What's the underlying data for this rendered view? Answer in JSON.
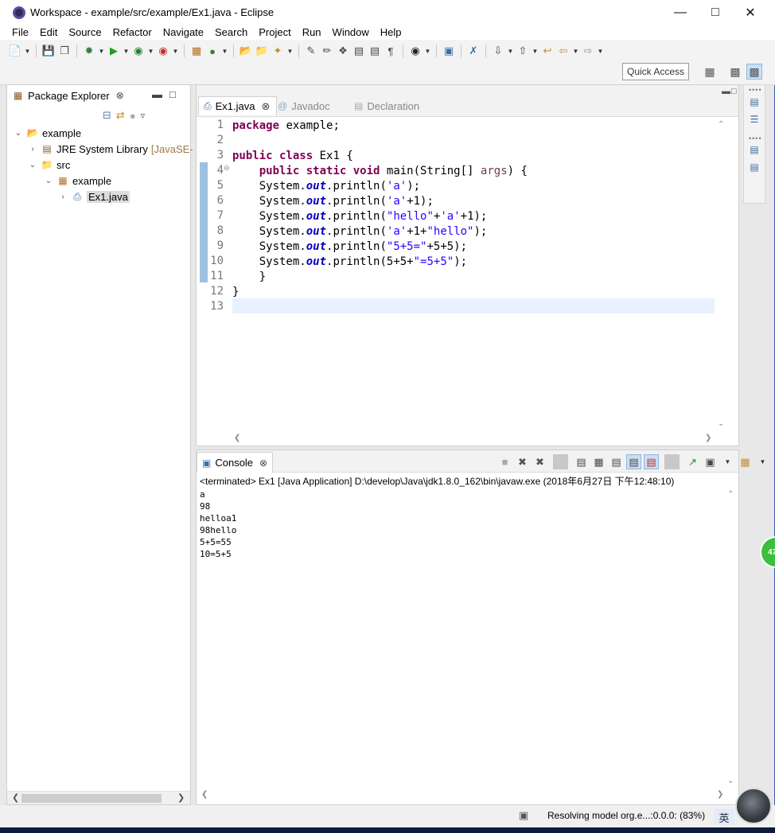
{
  "window": {
    "title": "Workspace - example/src/example/Ex1.java - Eclipse"
  },
  "menu": [
    "File",
    "Edit",
    "Source",
    "Refactor",
    "Navigate",
    "Search",
    "Project",
    "Run",
    "Window",
    "Help"
  ],
  "toolbar": {
    "quick_access": "Quick Access"
  },
  "package_explorer": {
    "title": "Package Explorer",
    "tree": [
      {
        "label": "example",
        "arrow": "⌄",
        "icon": "project-icon"
      },
      {
        "label": "JRE System Library",
        "suffix": "[JavaSE-",
        "arrow": "›",
        "icon": "library-icon"
      },
      {
        "label": "src",
        "arrow": "⌄",
        "icon": "source-folder-icon"
      },
      {
        "label": "example",
        "arrow": "⌄",
        "icon": "package-icon"
      },
      {
        "label": "Ex1.java",
        "arrow": "›",
        "icon": "java-file-icon"
      }
    ]
  },
  "editor": {
    "tabs": [
      {
        "label": "Ex1.java",
        "active": true
      },
      {
        "label": "Javadoc",
        "active": false
      },
      {
        "label": "Declaration",
        "active": false
      }
    ],
    "line_numbers": [
      "1",
      "2",
      "3",
      "4",
      "5",
      "6",
      "7",
      "8",
      "9",
      "10",
      "11",
      "12",
      "13"
    ],
    "code": {
      "l1_kw": "package",
      "l1_rest": " example;",
      "l3_kw1": "public",
      "l3_kw2": "class",
      "l3_rest": " Ex1 {",
      "l4_kw1": "public",
      "l4_kw2": "static",
      "l4_kw3": "void",
      "l4_mid": " main(String[] ",
      "l4_par": "args",
      "l4_end": ") {",
      "sys": "System.",
      "out": "out",
      "println": ".println(",
      "l5_str": "'a'",
      "l5_end": ");",
      "l6_str": "'a'",
      "l6_end": "+1);",
      "l7_str1": "\"hello\"",
      "l7_mid": "+",
      "l7_str2": "'a'",
      "l7_end": "+1);",
      "l8_str1": "'a'",
      "l8_mid": "+1+",
      "l8_str2": "\"hello\"",
      "l8_end": ");",
      "l9_str": "\"5+5=\"",
      "l9_end": "+5+5);",
      "l10_pre": "5+5+",
      "l10_str": "\"=5+5\"",
      "l10_end": ");",
      "l11": "    }",
      "l12": "}"
    }
  },
  "console": {
    "title": "Console",
    "status": "<terminated> Ex1 [Java Application] D:\\develop\\Java\\jdk1.8.0_162\\bin\\javaw.exe (2018年6月27日 下午12:48:10)",
    "output": [
      "a",
      "98",
      "helloa1",
      "98hello",
      "5+5=55",
      "10=5+5"
    ]
  },
  "statusbar": {
    "text": "Resolving model org.e...:0.0.0: (83%)",
    "ime": "英"
  },
  "badge": {
    "text": "47"
  },
  "colors": {
    "keyword": "#7f0055",
    "string": "#2a00ff",
    "static_field": "#0000c0",
    "current_line": "#e8f2fe",
    "selection_accent": "#9fc0e0"
  }
}
